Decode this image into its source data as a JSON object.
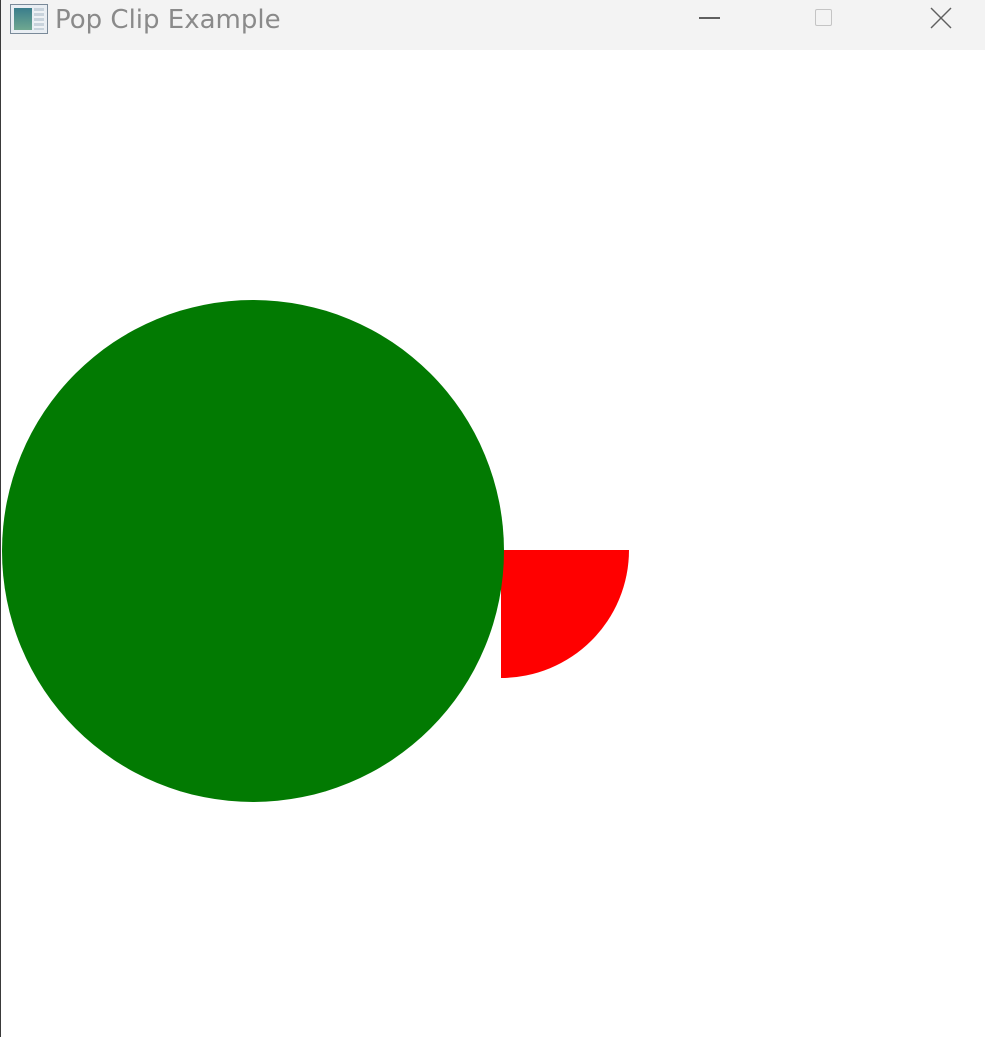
{
  "window": {
    "title": "Pop Clip Example",
    "icon": "app-window-icon"
  },
  "controls": {
    "minimize_icon": "minimize-icon",
    "maximize_icon": "maximize-icon",
    "close_icon": "close-icon"
  },
  "drawing": {
    "shapes": [
      {
        "kind": "circle",
        "color": "#027a02"
      },
      {
        "kind": "quarter-circle",
        "color": "#ff0000"
      }
    ]
  }
}
